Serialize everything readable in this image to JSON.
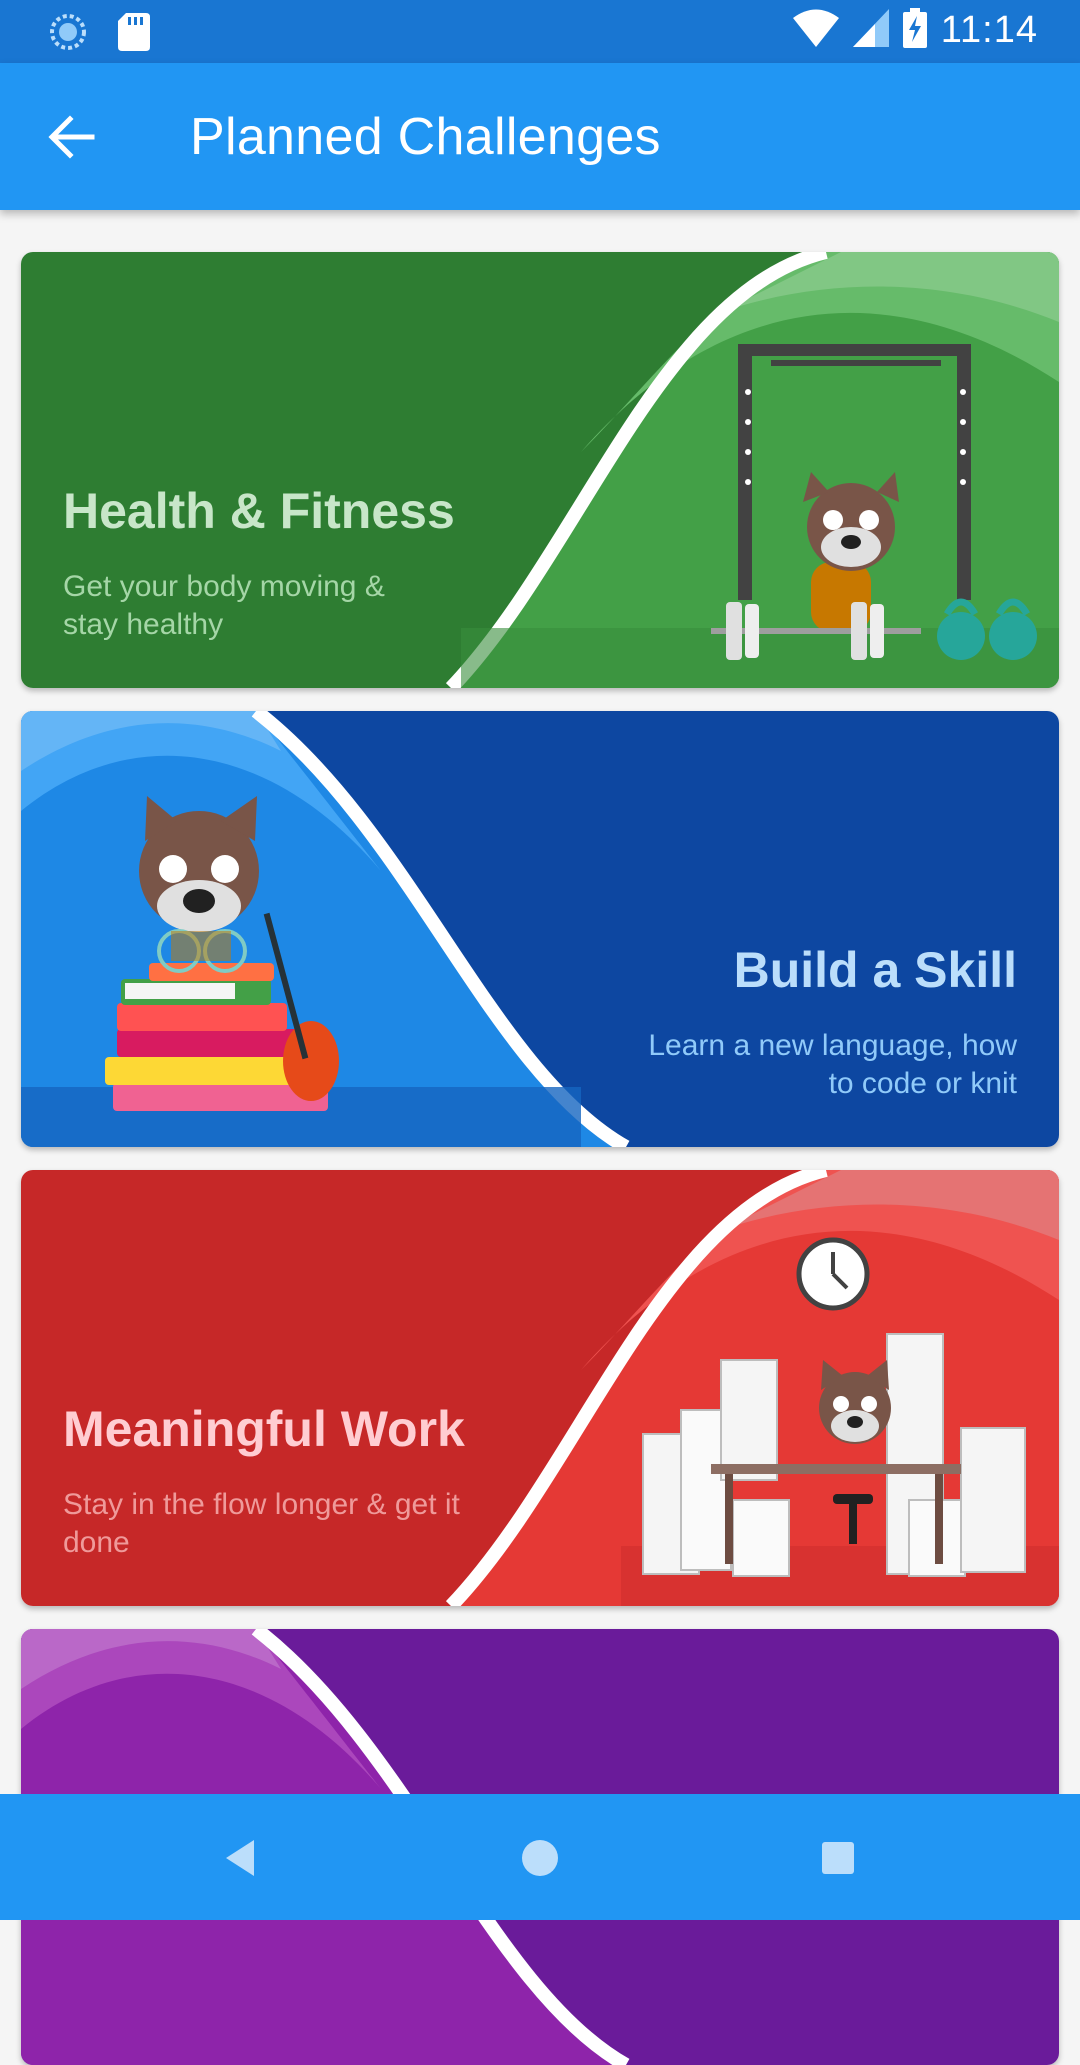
{
  "status_bar": {
    "time": "11:14",
    "icons": [
      "loading-icon",
      "sd-card-icon",
      "wifi-icon",
      "cell-signal-icon",
      "battery-charging-icon"
    ]
  },
  "app_bar": {
    "title": "Planned Challenges",
    "back_icon": "arrow-back-icon"
  },
  "cards": [
    {
      "title": "Health & Fitness",
      "subtitle_line1": "Get your body moving &",
      "subtitle_line2": "stay healthy",
      "colors": {
        "bg": "#2e7d32",
        "accent": "#43a047",
        "light": "#81c784",
        "text": "#c8e6c9"
      }
    },
    {
      "title": "Build a Skill",
      "subtitle_line1": "Learn a new language, how",
      "subtitle_line2": "to code or knit",
      "colors": {
        "bg": "#0d47a1",
        "accent": "#1e88e5",
        "light": "#64b5f6",
        "text": "#bbdefb"
      }
    },
    {
      "title": "Meaningful Work",
      "subtitle_line1": "Stay in the flow longer & get it",
      "subtitle_line2": "done",
      "colors": {
        "bg": "#c62828",
        "accent": "#e53935",
        "light": "#e57373",
        "text": "#ffcdd2"
      }
    },
    {
      "title": "",
      "colors": {
        "bg": "#6a1b9a",
        "accent": "#8e24aa",
        "light": "#ba68c8"
      }
    }
  ],
  "nav_bar": {
    "back": "nav-back-icon",
    "home": "nav-home-icon",
    "recents": "nav-recents-icon"
  }
}
